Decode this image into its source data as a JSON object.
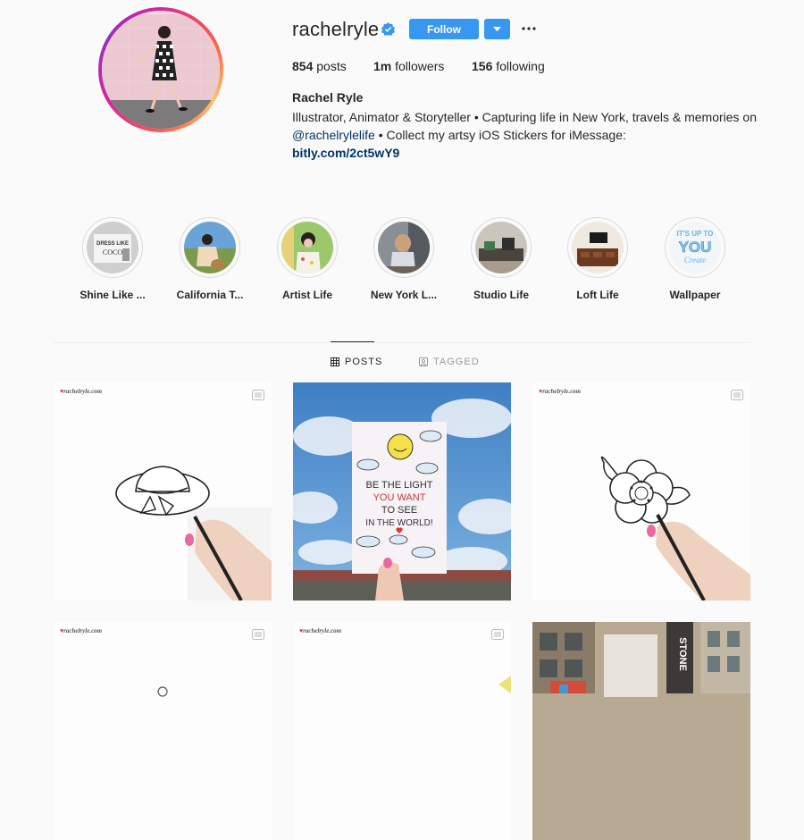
{
  "profile": {
    "username": "rachelryle",
    "follow_label": "Follow",
    "stats": {
      "posts_count": "854",
      "posts_label": "posts",
      "followers_count": "1m",
      "followers_label": "followers",
      "following_count": "156",
      "following_label": "following"
    },
    "full_name": "Rachel Ryle",
    "bio_line1": "Illustrator, Animator & Storyteller • Capturing life in New York, travels & memories on",
    "bio_mention": "@rachelrylelife",
    "bio_line2_rest": " • Collect my artsy iOS Stickers for iMessage:",
    "bio_link": "bitly.com/2ct5wY9"
  },
  "highlights": [
    {
      "label": "Shine Like ..."
    },
    {
      "label": "California T..."
    },
    {
      "label": "Artist Life"
    },
    {
      "label": "New York L..."
    },
    {
      "label": "Studio Life"
    },
    {
      "label": "Loft Life"
    },
    {
      "label": "Wallpaper"
    }
  ],
  "highlight_art_text": {
    "shine": "DRESS LIKE",
    "coco": "COCO",
    "wallpaper_1": "IT'S UP TO",
    "wallpaper_2": "YOU",
    "wallpaper_3": "Create"
  },
  "tabs": [
    {
      "label": "POSTS",
      "active": true,
      "icon": "grid-icon"
    },
    {
      "label": "TAGGED",
      "active": false,
      "icon": "tag-icon"
    }
  ],
  "posts": [
    {
      "type": "video",
      "watermark": "rachelryle.com",
      "subject": "hat-drawing"
    },
    {
      "type": "image",
      "card_line1": "BE THE LIGHT",
      "card_line2": "YOU WANT",
      "card_line3": "TO SEE",
      "card_line4": "IN THE WORLD!",
      "subject": "sky-card"
    },
    {
      "type": "video",
      "watermark": "rachelryle.com",
      "subject": "flower-drawing"
    },
    {
      "type": "video",
      "watermark": "rachelryle.com",
      "subject": "drawing"
    },
    {
      "type": "video",
      "watermark": "rachelryle.com",
      "subject": "drawing"
    },
    {
      "type": "image",
      "sign_text": "STONE",
      "subject": "street-building"
    }
  ],
  "colors": {
    "accent": "#3897f0",
    "link": "#003569",
    "verified": "#3897f0",
    "text": "#262626"
  }
}
